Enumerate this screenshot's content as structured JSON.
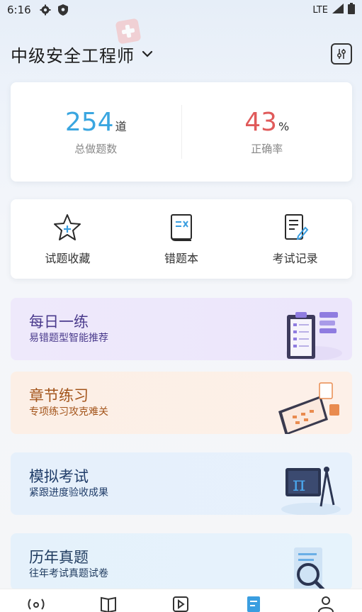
{
  "status": {
    "time": "6:16",
    "network": "LTE"
  },
  "header": {
    "title": "中级安全工程师"
  },
  "stats": {
    "total": {
      "value": "254",
      "unit": "道",
      "label": "总做题数",
      "color": "#3aa6e0"
    },
    "accuracy": {
      "value": "43",
      "unit": "%",
      "label": "正确率",
      "color": "#e05a5a"
    }
  },
  "tools": [
    {
      "label": "试题收藏",
      "icon": "star-plus-icon"
    },
    {
      "label": "错题本",
      "icon": "wrong-book-icon"
    },
    {
      "label": "考试记录",
      "icon": "exam-record-icon"
    }
  ],
  "features": [
    {
      "title": "每日一练",
      "subtitle": "易错题型智能推荐"
    },
    {
      "title": "章节练习",
      "subtitle": "专项练习攻克难关"
    },
    {
      "title": "模拟考试",
      "subtitle": "紧跟进度验收成果"
    },
    {
      "title": "历年真题",
      "subtitle": "往年考试真题试卷"
    }
  ],
  "tabs": [
    {
      "icon": "live-icon"
    },
    {
      "icon": "book-icon"
    },
    {
      "icon": "video-icon"
    },
    {
      "icon": "question-bank-icon",
      "active": true
    },
    {
      "icon": "profile-icon"
    }
  ]
}
